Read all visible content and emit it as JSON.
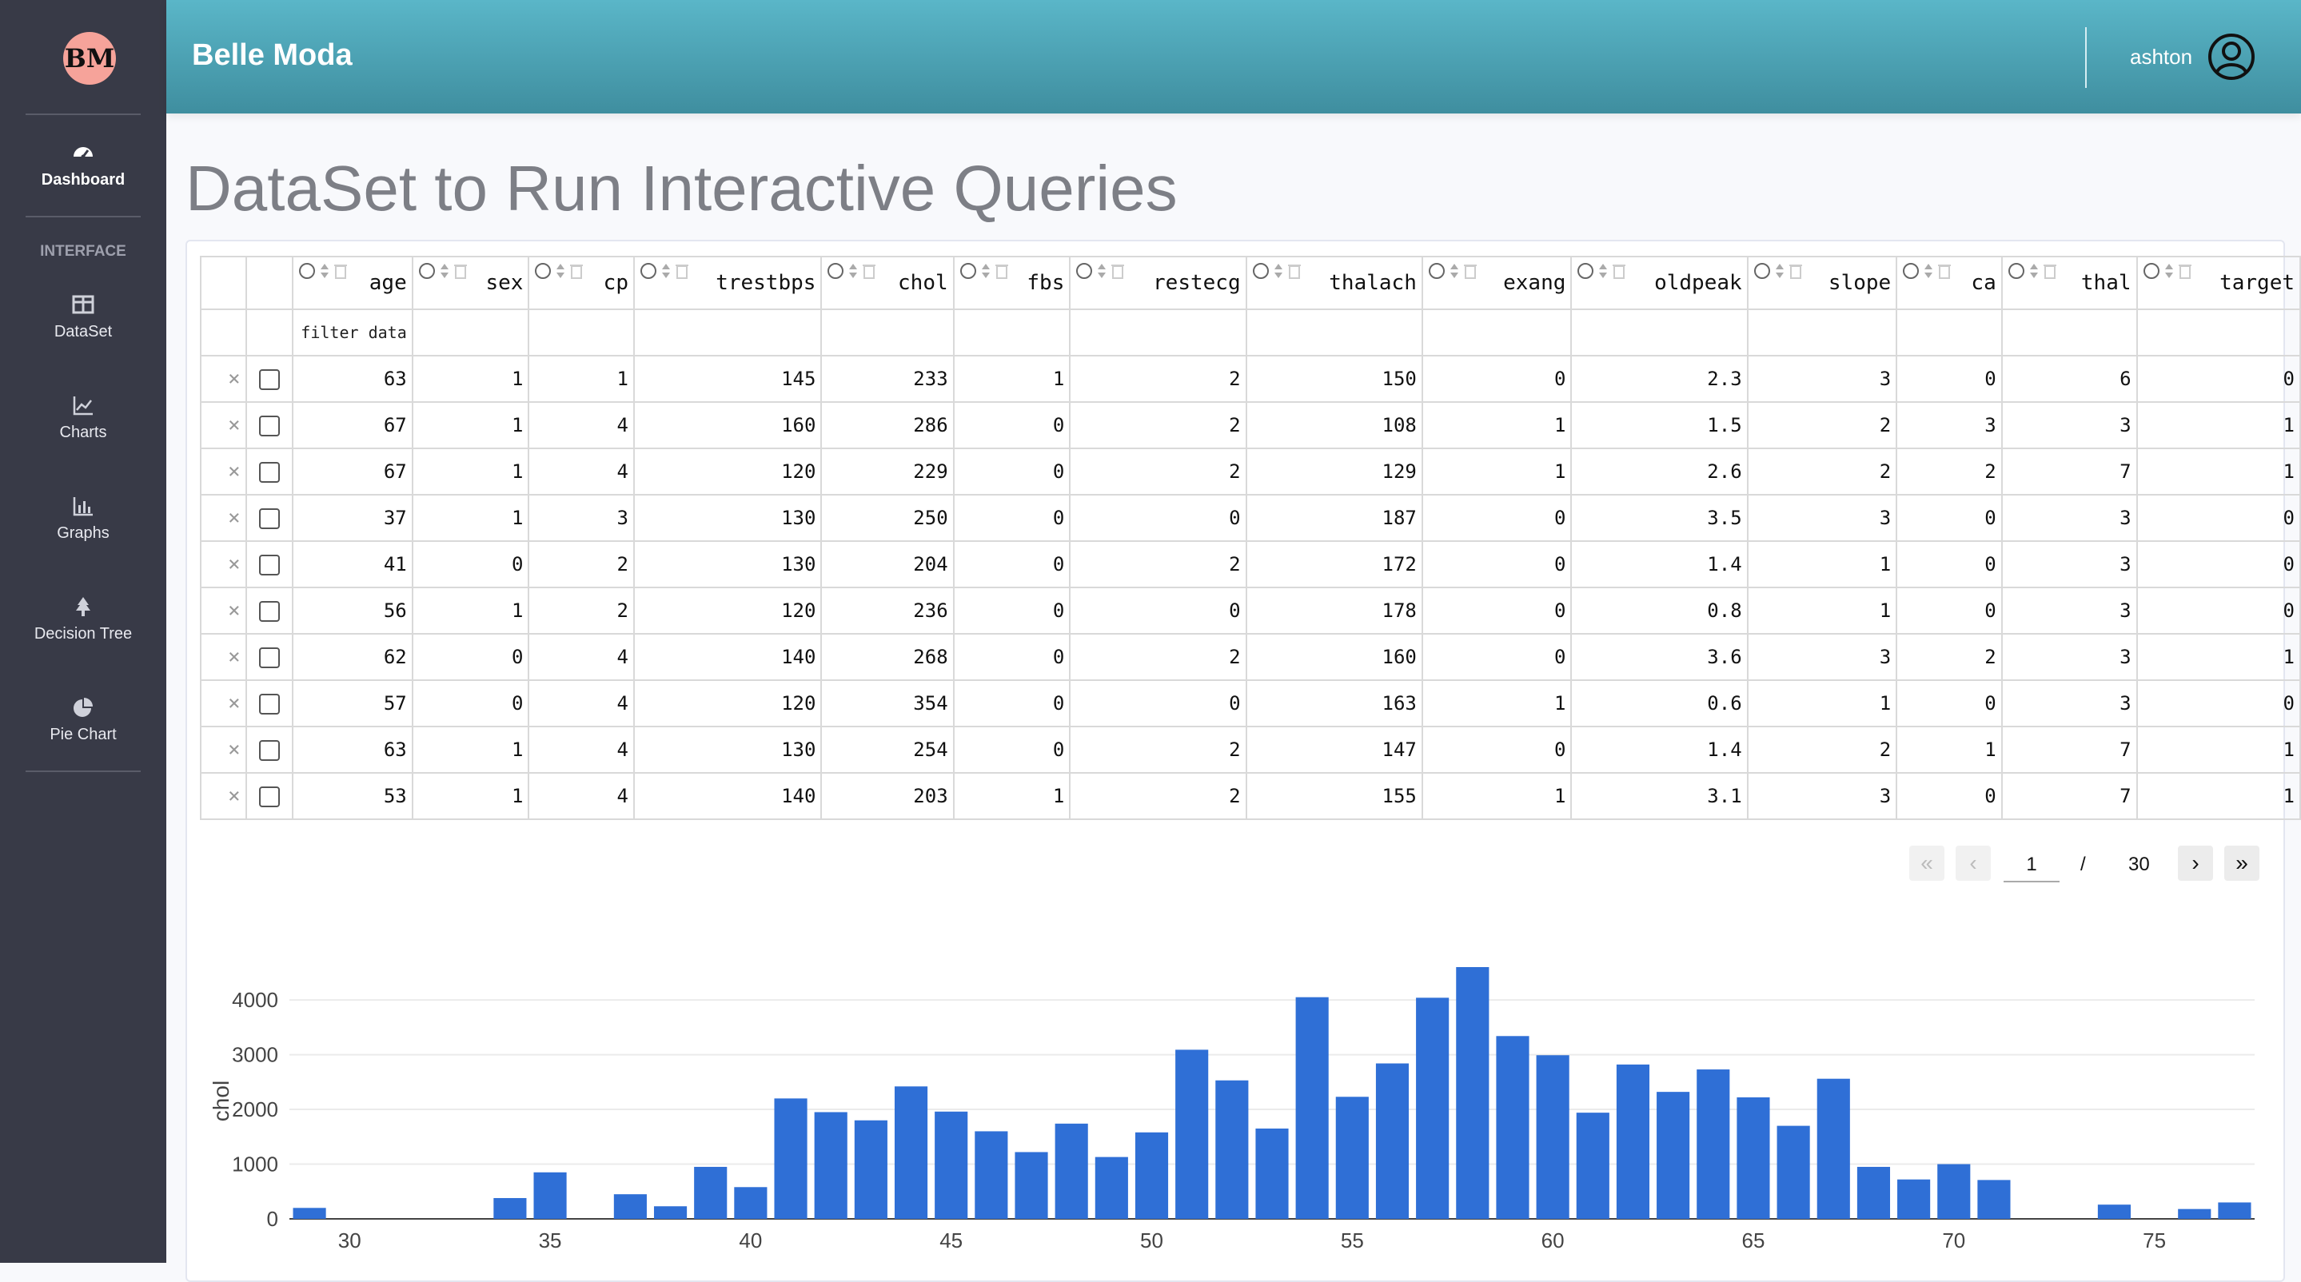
{
  "app": {
    "logo_text": "BM",
    "brand": "Belle Moda",
    "user": "ashton"
  },
  "sidebar": {
    "heading": "INTERFACE",
    "items": [
      {
        "label": "Dashboard",
        "icon": "dashboard-gauge-icon",
        "active": true
      },
      {
        "label": "DataSet",
        "icon": "table-icon"
      },
      {
        "label": "Charts",
        "icon": "line-chart-icon"
      },
      {
        "label": "Graphs",
        "icon": "bar-graph-icon"
      },
      {
        "label": "Decision Tree",
        "icon": "tree-icon"
      },
      {
        "label": "Pie Chart",
        "icon": "pie-chart-icon"
      }
    ]
  },
  "page": {
    "title": "DataSet to Run Interactive Queries"
  },
  "table": {
    "columns": [
      "age",
      "sex",
      "cp",
      "trestbps",
      "chol",
      "fbs",
      "restecg",
      "thalach",
      "exang",
      "oldpeak",
      "slope",
      "ca",
      "thal",
      "target"
    ],
    "filter_placeholder": "filter data",
    "rows": [
      [
        "63",
        "1",
        "1",
        "145",
        "233",
        "1",
        "2",
        "150",
        "0",
        "2.3",
        "3",
        "0",
        "6",
        "0"
      ],
      [
        "67",
        "1",
        "4",
        "160",
        "286",
        "0",
        "2",
        "108",
        "1",
        "1.5",
        "2",
        "3",
        "3",
        "1"
      ],
      [
        "67",
        "1",
        "4",
        "120",
        "229",
        "0",
        "2",
        "129",
        "1",
        "2.6",
        "2",
        "2",
        "7",
        "1"
      ],
      [
        "37",
        "1",
        "3",
        "130",
        "250",
        "0",
        "0",
        "187",
        "0",
        "3.5",
        "3",
        "0",
        "3",
        "0"
      ],
      [
        "41",
        "0",
        "2",
        "130",
        "204",
        "0",
        "2",
        "172",
        "0",
        "1.4",
        "1",
        "0",
        "3",
        "0"
      ],
      [
        "56",
        "1",
        "2",
        "120",
        "236",
        "0",
        "0",
        "178",
        "0",
        "0.8",
        "1",
        "0",
        "3",
        "0"
      ],
      [
        "62",
        "0",
        "4",
        "140",
        "268",
        "0",
        "2",
        "160",
        "0",
        "3.6",
        "3",
        "2",
        "3",
        "1"
      ],
      [
        "57",
        "0",
        "4",
        "120",
        "354",
        "0",
        "0",
        "163",
        "1",
        "0.6",
        "1",
        "0",
        "3",
        "0"
      ],
      [
        "63",
        "1",
        "4",
        "130",
        "254",
        "0",
        "2",
        "147",
        "0",
        "1.4",
        "2",
        "1",
        "7",
        "1"
      ],
      [
        "53",
        "1",
        "4",
        "140",
        "203",
        "1",
        "2",
        "155",
        "1",
        "3.1",
        "3",
        "0",
        "7",
        "1"
      ]
    ],
    "delete_glyph": "×"
  },
  "pagination": {
    "current": "1",
    "separator": "/",
    "total": "30"
  },
  "chart_data": {
    "type": "bar",
    "ylabel": "chol",
    "xlabel": "",
    "color": "#2f6fd6",
    "ylim": [
      0,
      4600
    ],
    "xlim": [
      28.5,
      77.5
    ],
    "yticks": [
      0,
      1000,
      2000,
      3000,
      4000
    ],
    "xticks": [
      30,
      35,
      40,
      45,
      50,
      55,
      60,
      65,
      70,
      75
    ],
    "x": [
      29,
      34,
      35,
      37,
      38,
      39,
      40,
      41,
      42,
      43,
      44,
      45,
      46,
      47,
      48,
      49,
      50,
      51,
      52,
      53,
      54,
      55,
      56,
      57,
      58,
      59,
      60,
      61,
      62,
      63,
      64,
      65,
      66,
      67,
      68,
      69,
      70,
      71,
      74,
      76,
      77
    ],
    "values": [
      200,
      380,
      850,
      450,
      230,
      950,
      580,
      2200,
      1950,
      1800,
      2420,
      1960,
      1600,
      1220,
      1740,
      1130,
      1580,
      3090,
      2530,
      1650,
      4050,
      2230,
      2840,
      4040,
      4600,
      3340,
      2990,
      1940,
      2820,
      2320,
      2730,
      2220,
      1700,
      2560,
      950,
      720,
      1000,
      710,
      260,
      180,
      300
    ]
  }
}
